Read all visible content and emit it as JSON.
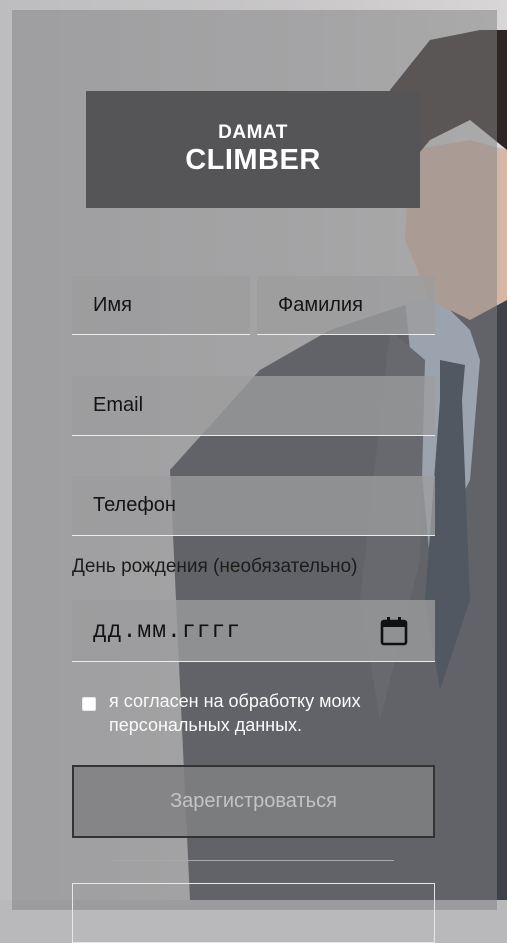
{
  "brand": {
    "line1": "DAMAT",
    "line2": "CLIMBER"
  },
  "form": {
    "first_name": {
      "placeholder": "Имя",
      "value": ""
    },
    "last_name": {
      "placeholder": "Фамилия",
      "value": ""
    },
    "email": {
      "placeholder": "Email",
      "value": ""
    },
    "phone": {
      "placeholder": "Телефон",
      "value": ""
    },
    "birthday_label": "День рождения (необязательно)",
    "birthday_placeholder": "дд.мм.гггг",
    "consent_text": "я согласен на обработку моих персональных данных.",
    "consent_checked": false,
    "register_label": "Зарегистроваться"
  },
  "colors": {
    "logo_bg": "#555456",
    "field_bg": "#9c9c9e",
    "button_border": "#333333"
  },
  "icons": [
    "calendar-icon"
  ]
}
